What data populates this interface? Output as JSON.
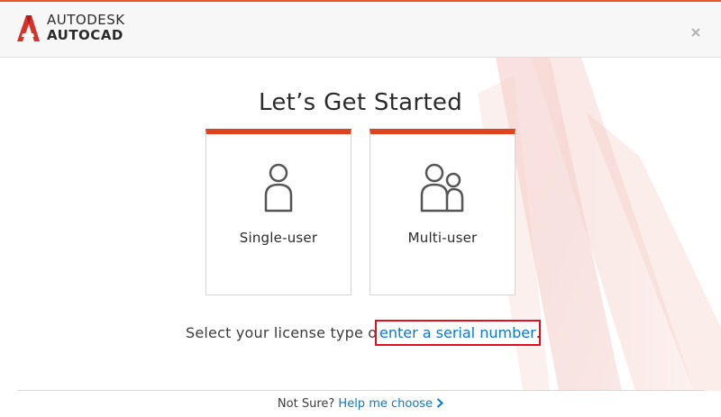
{
  "header": {
    "brand_line1": "AUTODESK",
    "brand_line2": "AUTOCAD",
    "close_symbol": "×",
    "close_icon": "close-icon",
    "logo_icon": "autocad-logo-icon"
  },
  "main": {
    "title": "Let’s Get Started",
    "cards": [
      {
        "label": "Single-user",
        "icon": "single-user-icon"
      },
      {
        "label": "Multi-user",
        "icon": "multi-user-icon"
      }
    ],
    "prompt_text": "Select your license type or ",
    "serial_link_text": "enter a serial number",
    "prompt_end": "."
  },
  "footer": {
    "not_sure": "Not Sure? ",
    "help_link": "Help me choose",
    "chevron_icon": "chevron-right-icon"
  },
  "colors": {
    "accent": "#e0431f",
    "link": "#0b79c7",
    "highlight_box": "#e0101e"
  }
}
